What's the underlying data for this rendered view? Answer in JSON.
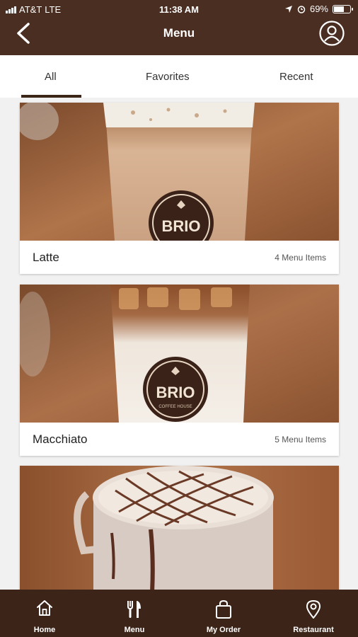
{
  "status_bar": {
    "carrier": "AT&T",
    "network": "LTE",
    "time": "11:38 AM",
    "battery": "69%",
    "battery_level": 0.69
  },
  "header": {
    "title": "Menu"
  },
  "tabs": [
    {
      "label": "All",
      "active": true
    },
    {
      "label": "Favorites",
      "active": false
    },
    {
      "label": "Recent",
      "active": false
    }
  ],
  "categories": [
    {
      "name": "Latte",
      "count": "4 Menu Items",
      "cup_logo": "BRIO"
    },
    {
      "name": "Macchiato",
      "count": "5 Menu Items",
      "cup_logo": "BRIO",
      "cup_sublogo": "COFFEE HOUSE"
    },
    {
      "name": "",
      "count": ""
    }
  ],
  "bottom_nav": [
    {
      "label": "Home",
      "icon": "home-icon"
    },
    {
      "label": "Menu",
      "icon": "utensils-icon"
    },
    {
      "label": "My Order",
      "icon": "bag-icon"
    },
    {
      "label": "Restaurant",
      "icon": "location-pin-icon"
    }
  ],
  "colors": {
    "brand": "#4a2e22",
    "nav": "#3d2418",
    "tab_underline": "#3b2418"
  }
}
